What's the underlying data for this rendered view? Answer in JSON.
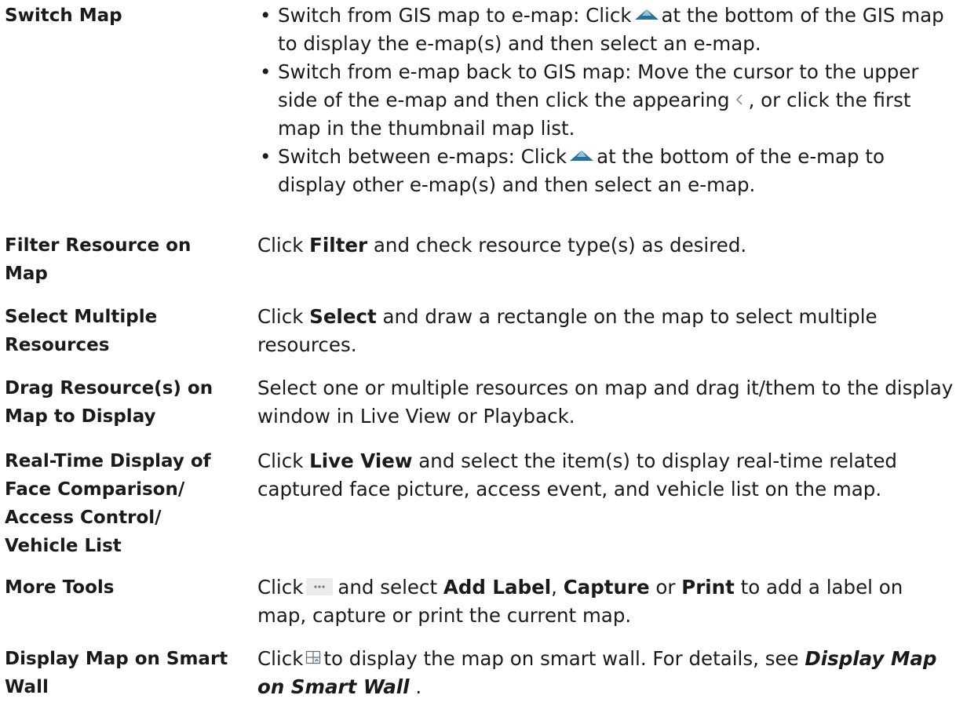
{
  "rows": [
    {
      "term": "Switch Map",
      "bullets": [
        {
          "a": "Switch from GIS map to e-map: Click",
          "icon": "mountain-icon",
          "b": "at the bottom of the GIS map to display the e-map(s) and then select an e-map."
        },
        {
          "a": "Switch from e-map back to GIS map: Move the cursor to the upper side of the e-map and then click the appearing",
          "icon": "chevron-left-icon",
          "b": ", or click the first map in the thumbnail map list."
        },
        {
          "a": "Switch between e-maps: Click",
          "icon": "mountain-icon",
          "b": "at the bottom of the e-map to display other e-map(s) and then select an e-map."
        }
      ]
    },
    {
      "term": "Filter Resource on Map",
      "desc": {
        "a": "Click ",
        "bold": "Filter",
        "b": " and check resource type(s) as desired."
      }
    },
    {
      "term": "Select Multiple Resources",
      "desc": {
        "a": "Click ",
        "bold": "Select",
        "b": " and draw a rectangle on the map to select multiple resources."
      }
    },
    {
      "term": "Drag Resource(s) on Map to Display",
      "desc": {
        "text": "Select one or multiple resources on map and drag it/them to the display window in Live View or Playback."
      }
    },
    {
      "term": "Real-Time Display of Face Comparison/ Access Control/ Vehicle List",
      "desc": {
        "a": "Click ",
        "bold": "Live View",
        "b": " and select the item(s) to display real-time related captured face picture, access event, and vehicle list on the map."
      }
    },
    {
      "term": "More Tools",
      "desc": {
        "a": "Click",
        "icon": "more-icon",
        "b": "and select ",
        "bold1": "Add Label",
        "sep1": ", ",
        "bold2": "Capture",
        "sep2": " or ",
        "bold3": "Print",
        "c": " to add a label on map, capture or print the current map."
      }
    },
    {
      "term": "Display Map on Smart Wall",
      "desc": {
        "a": "Click",
        "icon": "smart-wall-icon",
        "b": "to display the map on smart wall. For details, see ",
        "link": "Display Map on Smart Wall",
        "c": " ."
      }
    }
  ]
}
